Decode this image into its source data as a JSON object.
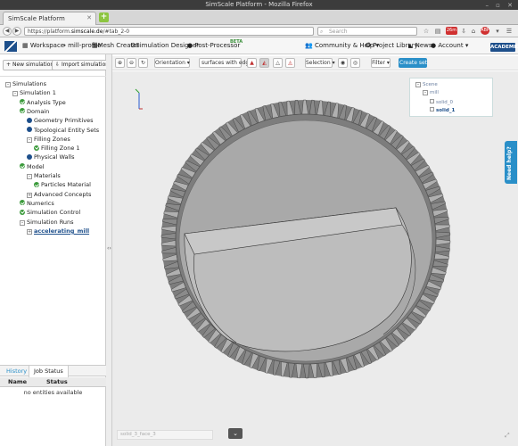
{
  "browser": {
    "window_title": "SimScale Platform - Mozilla Firefox",
    "tab_label": "SimScale Platform",
    "url_prefix": "https://platform.",
    "url_domain": "simscale.de",
    "url_suffix": "/#tab_2-0",
    "search_placeholder": "Search",
    "badge_text": "26m",
    "abp_text": "ABP"
  },
  "app_header": {
    "workspace": "Workspace",
    "project": "mill-profile",
    "mesh_creator": "Mesh Creator",
    "simulation_designer": "Simulation Designer",
    "post_processor": "Post-Processor",
    "beta": "BETA",
    "community": "Community & Help",
    "project_library": "Project Library",
    "news": "News",
    "account": "Account",
    "academic": "ACADEMIC"
  },
  "left_panel": {
    "new_simulation": "New simulation",
    "import_simulation": "Import simulation",
    "tree": [
      {
        "label": "Simulations",
        "indent": 0,
        "marker": "toggle"
      },
      {
        "label": "Simulation 1",
        "indent": 1,
        "marker": "toggle"
      },
      {
        "label": "Analysis Type",
        "indent": 2,
        "marker": "ok"
      },
      {
        "label": "Domain",
        "indent": 2,
        "marker": "ok"
      },
      {
        "label": "Geometry Primitives",
        "indent": 3,
        "marker": "dot"
      },
      {
        "label": "Topological Entity Sets",
        "indent": 3,
        "marker": "dot"
      },
      {
        "label": "Filling Zones",
        "indent": 3,
        "marker": "toggle"
      },
      {
        "label": "Filling Zone 1",
        "indent": 4,
        "marker": "ok"
      },
      {
        "label": "Physical Walls",
        "indent": 3,
        "marker": "dot"
      },
      {
        "label": "Model",
        "indent": 2,
        "marker": "ok"
      },
      {
        "label": "Materials",
        "indent": 3,
        "marker": "toggle"
      },
      {
        "label": "Particles Material",
        "indent": 4,
        "marker": "ok"
      },
      {
        "label": "Advanced Concepts",
        "indent": 3,
        "marker": "toggle-plus"
      },
      {
        "label": "Numerics",
        "indent": 2,
        "marker": "ok"
      },
      {
        "label": "Simulation Control",
        "indent": 2,
        "marker": "ok"
      },
      {
        "label": "Simulation Runs",
        "indent": 2,
        "marker": "toggle"
      },
      {
        "label": "accelerating_mill",
        "indent": 3,
        "marker": "toggle-plus",
        "link": true
      }
    ],
    "tab_history": "History",
    "tab_job_status": "Job Status",
    "col_name": "Name",
    "col_status": "Status",
    "empty_message": "no entities available"
  },
  "toolbar": {
    "orientation": "Orientation",
    "render_mode": "surfaces with edg",
    "selection": "Selection",
    "filter": "Filter",
    "create_set": "Create set"
  },
  "scene": {
    "root": "Scene",
    "child": "mill",
    "items": [
      "solid_0",
      "solid_1"
    ]
  },
  "viewport": {
    "selection_placeholder": "solid_3_face_3",
    "need_help": "Need help?"
  },
  "colors": {
    "brand": "#1d4f8b",
    "accent": "#2a8fc8",
    "ok_green": "#3a9a3a"
  }
}
